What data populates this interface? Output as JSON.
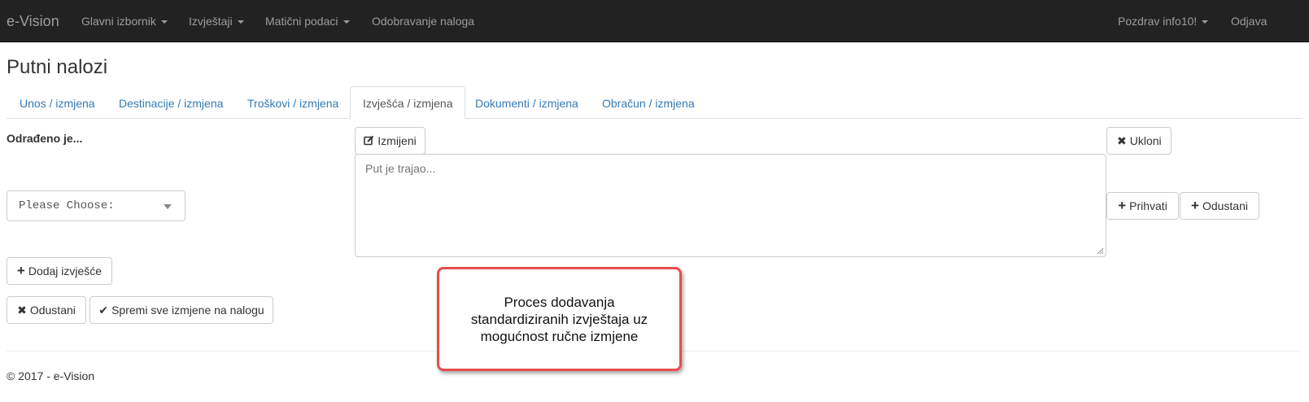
{
  "navbar": {
    "brand": "e-Vision",
    "menu": [
      {
        "label": "Glavni izbornik",
        "dropdown": true
      },
      {
        "label": "Izvještaji",
        "dropdown": true
      },
      {
        "label": "Matični podaci",
        "dropdown": true
      },
      {
        "label": "Odobravanje naloga",
        "dropdown": false
      }
    ],
    "greeting": "Pozdrav info10!",
    "logout": "Odjava"
  },
  "page_title": "Putni nalozi",
  "tabs": [
    {
      "label": "Unos / izmjena",
      "active": false
    },
    {
      "label": "Destinacije / izmjena",
      "active": false
    },
    {
      "label": "Troškovi / izmjena",
      "active": false
    },
    {
      "label": "Izvješća / izmjena",
      "active": true
    },
    {
      "label": "Dokumenti / izmjena",
      "active": false
    },
    {
      "label": "Obračun / izmjena",
      "active": false
    }
  ],
  "form": {
    "field_label": "Odrađeno je...",
    "select_value": "Please Choose:",
    "edit_button": "Izmijeni",
    "remove_button": "Ukloni",
    "textarea_placeholder": "Put je trajao...",
    "accept_button": "Prihvati",
    "cancel_small_button": "Odustani",
    "add_report_button": "Dodaj izvješće",
    "cancel_button": "Odustani",
    "save_all_button": "Spremi sve izmjene na nalogu"
  },
  "callout_text": "Proces dodavanja standardiziranih izvještaja uz mogućnost ručne izmjene",
  "footer": "© 2017 - e-Vision",
  "colors": {
    "navbar_bg": "#222222",
    "link": "#337ab7",
    "callout_border": "#e84c4c"
  }
}
